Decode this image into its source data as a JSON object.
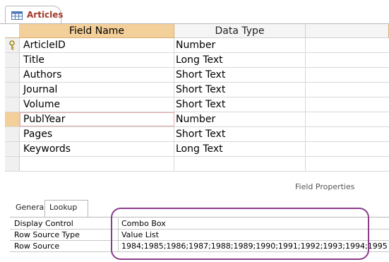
{
  "tab": {
    "label": "Articles"
  },
  "grid": {
    "headers": {
      "field_name": "Field Name",
      "data_type": "Data Type"
    },
    "rows": [
      {
        "field": "ArticleID",
        "type": "Number"
      },
      {
        "field": "Title",
        "type": "Long Text"
      },
      {
        "field": "Authors",
        "type": "Short Text"
      },
      {
        "field": "Journal",
        "type": "Short Text"
      },
      {
        "field": "Volume",
        "type": "Short Text"
      },
      {
        "field": "PublYear",
        "type": "Number"
      },
      {
        "field": "Pages",
        "type": "Short Text"
      },
      {
        "field": "Keywords",
        "type": "Long Text"
      },
      {
        "field": "",
        "type": ""
      }
    ]
  },
  "field_properties": {
    "label": "Field Properties",
    "tabs": {
      "general": "General",
      "lookup": "Lookup"
    },
    "props": [
      {
        "name": "Display Control",
        "value": "Combo Box"
      },
      {
        "name": "Row Source Type",
        "value": "Value List"
      },
      {
        "name": "Row Source",
        "value": "1984;1985;1986;1987;1988;1989;1990;1991;1992;1993;1994;1995"
      }
    ]
  },
  "colors": {
    "header": "#f3cf9a",
    "tab_label": "#a33a2a",
    "highlight": "#8a3d8a"
  }
}
